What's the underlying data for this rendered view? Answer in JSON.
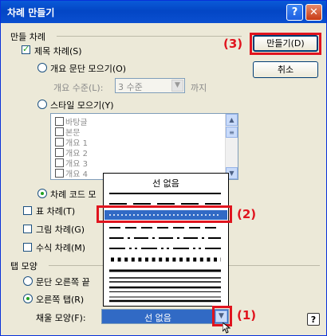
{
  "window": {
    "title": "차례 만들기",
    "help_btn": "?",
    "close_btn": "✕"
  },
  "groups": {
    "make_toc": "만들 차례",
    "tab_shape": "탭 모양"
  },
  "options": {
    "heading_toc": "제목 차례(S)",
    "outline_collect": "개요 문단 모으기(O)",
    "outline_level_label": "개요 수준(L):",
    "outline_level_value": "3 수준",
    "outline_level_suffix": "까지",
    "style_collect": "스타일 모으기(Y)",
    "toc_code": "차례 코드 모",
    "table_toc": "표 차례(T)",
    "figure_toc": "그림 차례(G)",
    "equation_toc": "수식 차례(M)",
    "para_right": "문단 오른쪽 끝",
    "right_tab": "오른쪽 탭(R)",
    "fill_shape_label": "채울 모양(F):",
    "fill_shape_value": "선 없음"
  },
  "style_list": [
    "바탕글",
    "본문",
    "개요 1",
    "개요 2",
    "개요 3",
    "개요 4"
  ],
  "buttons": {
    "make": "만들기(D)",
    "cancel": "취소"
  },
  "dropdown": {
    "header": "선 없음"
  },
  "annotations": {
    "step1": "(1)",
    "step2": "(2)",
    "step3": "(3)"
  },
  "colors": {
    "titlebar": "#0a4fd0",
    "annotation": "#e0141e",
    "selection": "#316ac5",
    "dialog_bg": "#ece9d8"
  }
}
